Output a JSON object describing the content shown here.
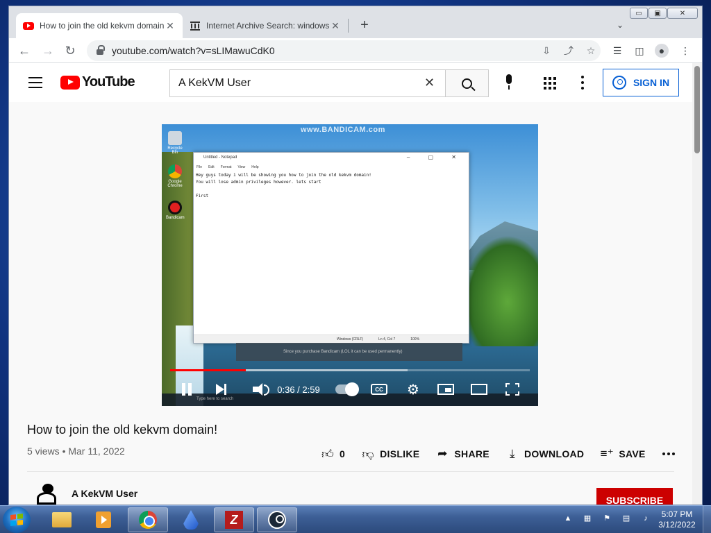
{
  "browser": {
    "tabs": [
      {
        "title": "How to join the old kekvm domain!",
        "close": "✕"
      },
      {
        "title": "Internet Archive Search: windows",
        "close": "✕"
      }
    ],
    "new_tab": "+",
    "tab_search": "⌄",
    "url": "youtube.com/watch?v=sLIMawuCdK0",
    "window_controls": {
      "minimize": "▭",
      "maximize": "▣",
      "close": "✕"
    }
  },
  "youtube": {
    "logo_text": "YouTube",
    "search_value": "A KekVM User",
    "search_clear": "✕",
    "sign_in": "SIGN IN"
  },
  "video_frame": {
    "watermark": "www.BANDICAM.com",
    "desktop_icons": [
      "Recycle Bin",
      "Google Chrome",
      "Bandicam"
    ],
    "notepad_title": "Untitled - Notepad",
    "notepad_controls": "‒ ▢ ✕",
    "notepad_menu": [
      "File",
      "Edit",
      "Format",
      "View",
      "Help"
    ],
    "notepad_text": "Hey guys today i will be showing you how to join the old kekvm domain!\nYou will lose admin privileges however. lets start\n\nFirst",
    "notepad_status": [
      "Windows (CRLF)",
      "Ln 4, Col 7",
      "100%"
    ],
    "toast": "Since you purchase Bandicam (LOL it can be used permanently)",
    "taskbar_search": "Type here to search"
  },
  "player": {
    "progress_played": 0.21,
    "progress_buffered": 0.66,
    "time": "0:36 / 2:59",
    "cc": "CC"
  },
  "video": {
    "title": "How to join the old kekvm domain!",
    "meta": "5 views • Mar 11, 2022",
    "likes": "0",
    "dislike": "DISLIKE",
    "share": "SHARE",
    "download": "DOWNLOAD",
    "save": "SAVE"
  },
  "channel": {
    "name": "A KekVM User",
    "subscribe": "SUBSCRIBE"
  },
  "taskbar": {
    "time": "5:07 PM",
    "date": "3/12/2022"
  },
  "colors": {
    "yt_red": "#ff0000",
    "subscribe_red": "#cc0000",
    "sign_in_blue": "#065fd4"
  }
}
